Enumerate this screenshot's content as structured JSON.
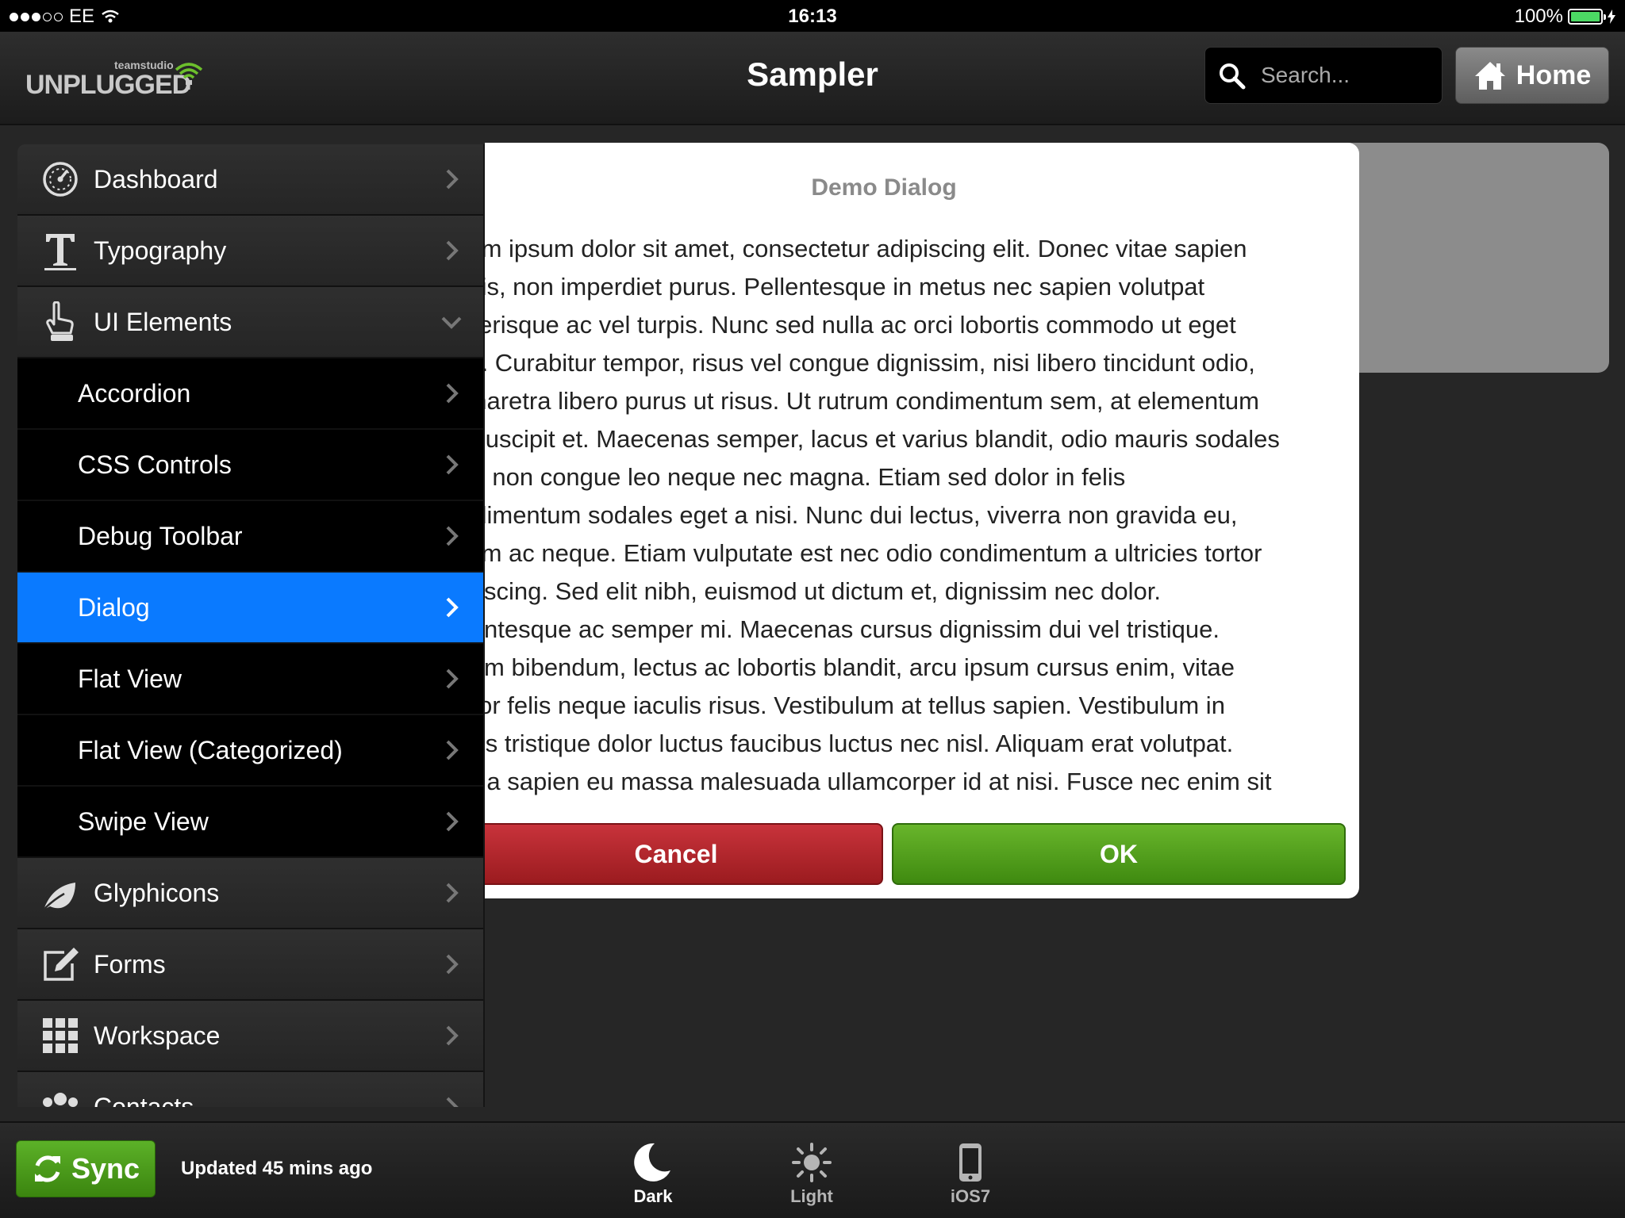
{
  "status_bar": {
    "carrier": "EE",
    "time": "16:13",
    "battery": "100%"
  },
  "header": {
    "logo_small": "teamstudio",
    "logo_big": "UNPLUGGED",
    "title": "Sampler",
    "search_placeholder": "Search...",
    "home_label": "Home"
  },
  "sidebar": {
    "items": [
      {
        "label": "Dashboard"
      },
      {
        "label": "Typography"
      },
      {
        "label": "UI Elements"
      },
      {
        "label": "Accordion"
      },
      {
        "label": "CSS Controls"
      },
      {
        "label": "Debug Toolbar"
      },
      {
        "label": "Dialog"
      },
      {
        "label": "Flat View"
      },
      {
        "label": "Flat View (Categorized)"
      },
      {
        "label": "Swipe View"
      },
      {
        "label": "Glyphicons"
      },
      {
        "label": "Forms"
      },
      {
        "label": "Workspace"
      },
      {
        "label": "Contacts"
      }
    ]
  },
  "dialog": {
    "title": "Demo Dialog",
    "lines": [
      "rem ipsum dolor sit amet, consectetur adipiscing elit. Donec vitae sapien",
      "uris, non imperdiet purus. Pellentesque in metus nec sapien volutpat",
      "elerisque ac vel turpis. Nunc sed nulla ac orci lobortis commodo ut eget",
      "ro. Curabitur tempor, risus vel congue dignissim, nisi libero tincidunt odio,",
      "pharetra libero purus ut risus. Ut rutrum condimentum sem, at elementum",
      "t suscipit et. Maecenas semper, lacus et varius blandit, odio mauris sodales",
      "la, non congue leo neque nec magna. Etiam sed dolor in felis",
      "ndimentum sodales eget a nisi. Nunc dui lectus, viverra non gravida eu,",
      "rum ac neque. Etiam vulputate est nec odio condimentum a ultricies tortor",
      "ipiscing. Sed elit nibh, euismod ut dictum et, dignissim nec dolor.",
      "llentesque ac semper mi. Maecenas cursus dignissim dui vel tristique.",
      "liam bibendum, lectus ac lobortis blandit, arcu ipsum cursus enim, vitae",
      "ctor felis neque iaculis risus. Vestibulum at tellus sapien. Vestibulum in",
      "cus tristique dolor luctus faucibus luctus nec nisl. Aliquam erat volutpat.",
      "m a sapien eu massa malesuada ullamcorper id at nisi. Fusce nec enim sit"
    ],
    "cancel_label": "Cancel",
    "ok_label": "OK"
  },
  "footer": {
    "sync_label": "Sync",
    "updated_text": "Updated 45 mins ago",
    "themes": [
      {
        "label": "Dark"
      },
      {
        "label": "Light"
      },
      {
        "label": "iOS7"
      }
    ]
  },
  "colors": {
    "active_item": "#0a7aff",
    "ok_button": "#4c9a18",
    "cancel_button": "#b0252b",
    "sync_button": "#4a9d1a",
    "battery": "#4cd964"
  }
}
